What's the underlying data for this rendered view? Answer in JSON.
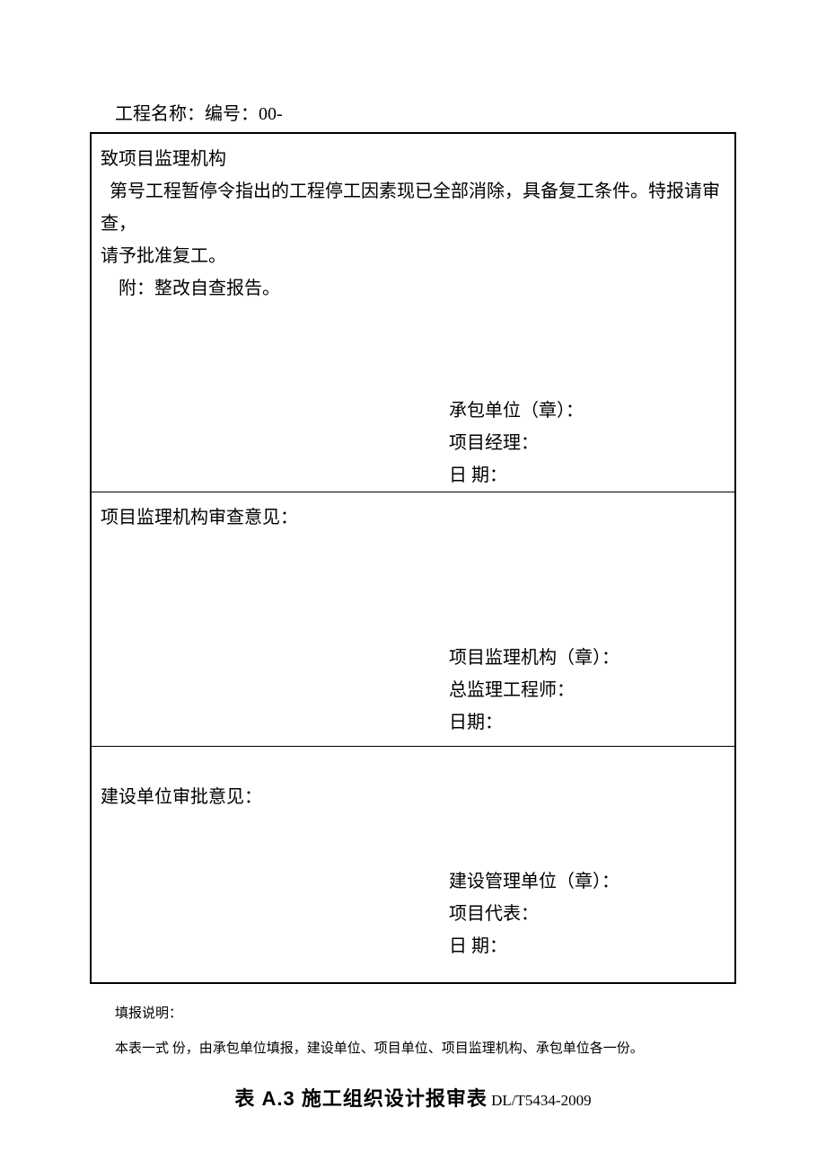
{
  "header": {
    "line": "工程名称：编号：00-"
  },
  "section1": {
    "line1": "致项目监理机构",
    "line2": "第号工程暂停令指出的工程停工因素现已全部消除，具备复工条件。特报请审查，",
    "line3": "请予批准复工。",
    "line4": "附：整改自查报告。",
    "sig": {
      "unit": "承包单位（章）：",
      "manager": "项目经理：",
      "date": "日  期："
    }
  },
  "section2": {
    "title": "项目监理机构审查意见：",
    "sig": {
      "unit": "项目监理机构（章）：",
      "engineer": "总监理工程师：",
      "date": "日期："
    }
  },
  "section3": {
    "title": "建设单位审批意见：",
    "sig": {
      "unit": "建设管理单位（章）：",
      "rep": "项目代表：",
      "date": "日        期："
    }
  },
  "notes": {
    "line1": "填报说明：",
    "line2": "本表一式    份，由承包单位填报，建设单位、项目单位、项目监理机构、承包单位各一份。"
  },
  "footer": {
    "title_bold": "表 A.3 施工组织设计报审表",
    "title_std": " DL/T5434-2009"
  }
}
